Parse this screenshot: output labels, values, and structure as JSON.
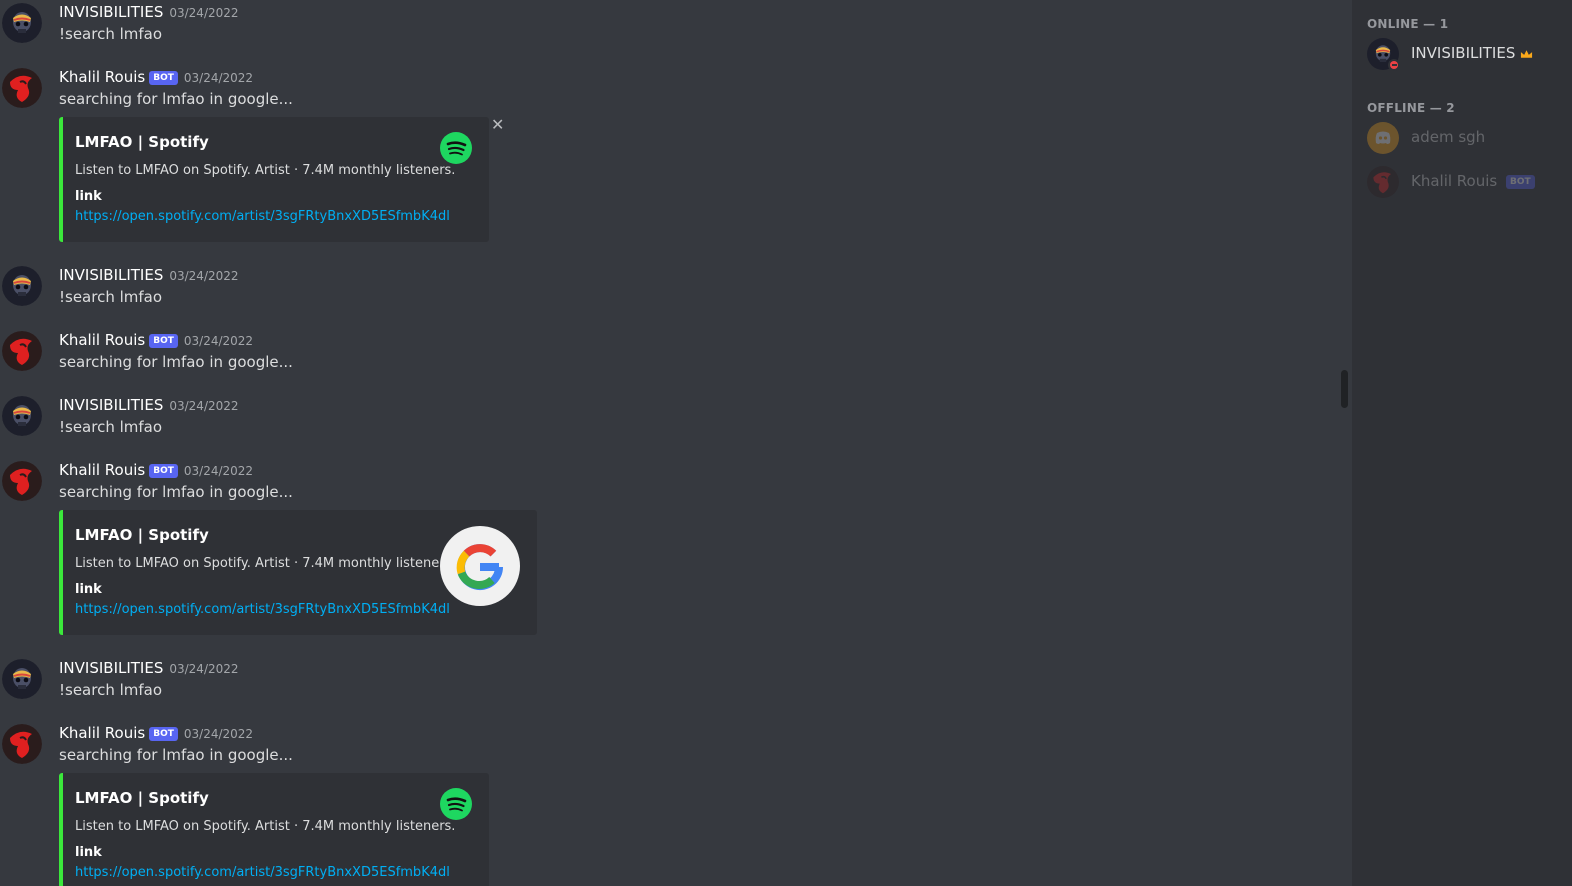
{
  "colors": {
    "background": "#36393f",
    "sidebar": "#2f3136",
    "embed_accent": "#3be83b",
    "link": "#00aff4",
    "bot_badge": "#5865f2"
  },
  "messages": [
    {
      "username": "INVISIBILITIES",
      "timestamp": "03/24/2022",
      "text": "!search lmfao"
    },
    {
      "username": "Khalil Rouis",
      "badge": "BOT",
      "timestamp": "03/24/2022",
      "text": "searching for lmfao in google...",
      "embed": {
        "title": "LMFAO | Spotify",
        "description": "Listen to LMFAO on Spotify. Artist · 7.4M monthly listeners.",
        "field_name": "link",
        "field_value": "https://open.spotify.com/artist/3sgFRtyBnxXD5ESfmbK4dl",
        "thumbnail": "spotify-icon",
        "dismissible": true
      }
    },
    {
      "username": "INVISIBILITIES",
      "timestamp": "03/24/2022",
      "text": "!search lmfao"
    },
    {
      "username": "Khalil Rouis",
      "badge": "BOT",
      "timestamp": "03/24/2022",
      "text": "searching for lmfao in google..."
    },
    {
      "username": "INVISIBILITIES",
      "timestamp": "03/24/2022",
      "text": "!search lmfao"
    },
    {
      "username": "Khalil Rouis",
      "badge": "BOT",
      "timestamp": "03/24/2022",
      "text": "searching for lmfao in google...",
      "embed": {
        "title": "LMFAO | Spotify",
        "description": "Listen to LMFAO on Spotify. Artist · 7.4M monthly listeners.",
        "field_name": "link",
        "field_value": "https://open.spotify.com/artist/3sgFRtyBnxXD5ESfmbK4dl",
        "thumbnail": "google-icon"
      }
    },
    {
      "username": "INVISIBILITIES",
      "timestamp": "03/24/2022",
      "text": "!search lmfao"
    },
    {
      "username": "Khalil Rouis",
      "badge": "BOT",
      "timestamp": "03/24/2022",
      "text": "searching for lmfao in google...",
      "embed": {
        "title": "LMFAO | Spotify",
        "description": "Listen to LMFAO on Spotify. Artist · 7.4M monthly listeners.",
        "field_name": "link",
        "field_value": "https://open.spotify.com/artist/3sgFRtyBnxXD5ESfmbK4dl",
        "thumbnail": "spotify-icon"
      }
    }
  ],
  "members": {
    "online_label": "ONLINE — 1",
    "offline_label": "OFFLINE — 2",
    "online": [
      {
        "name": "INVISIBILITIES",
        "icon": "crown-icon",
        "status": "do-not-disturb"
      }
    ],
    "offline": [
      {
        "name": "adem sgh"
      },
      {
        "name": "Khalil Rouis",
        "badge": "BOT"
      }
    ]
  }
}
